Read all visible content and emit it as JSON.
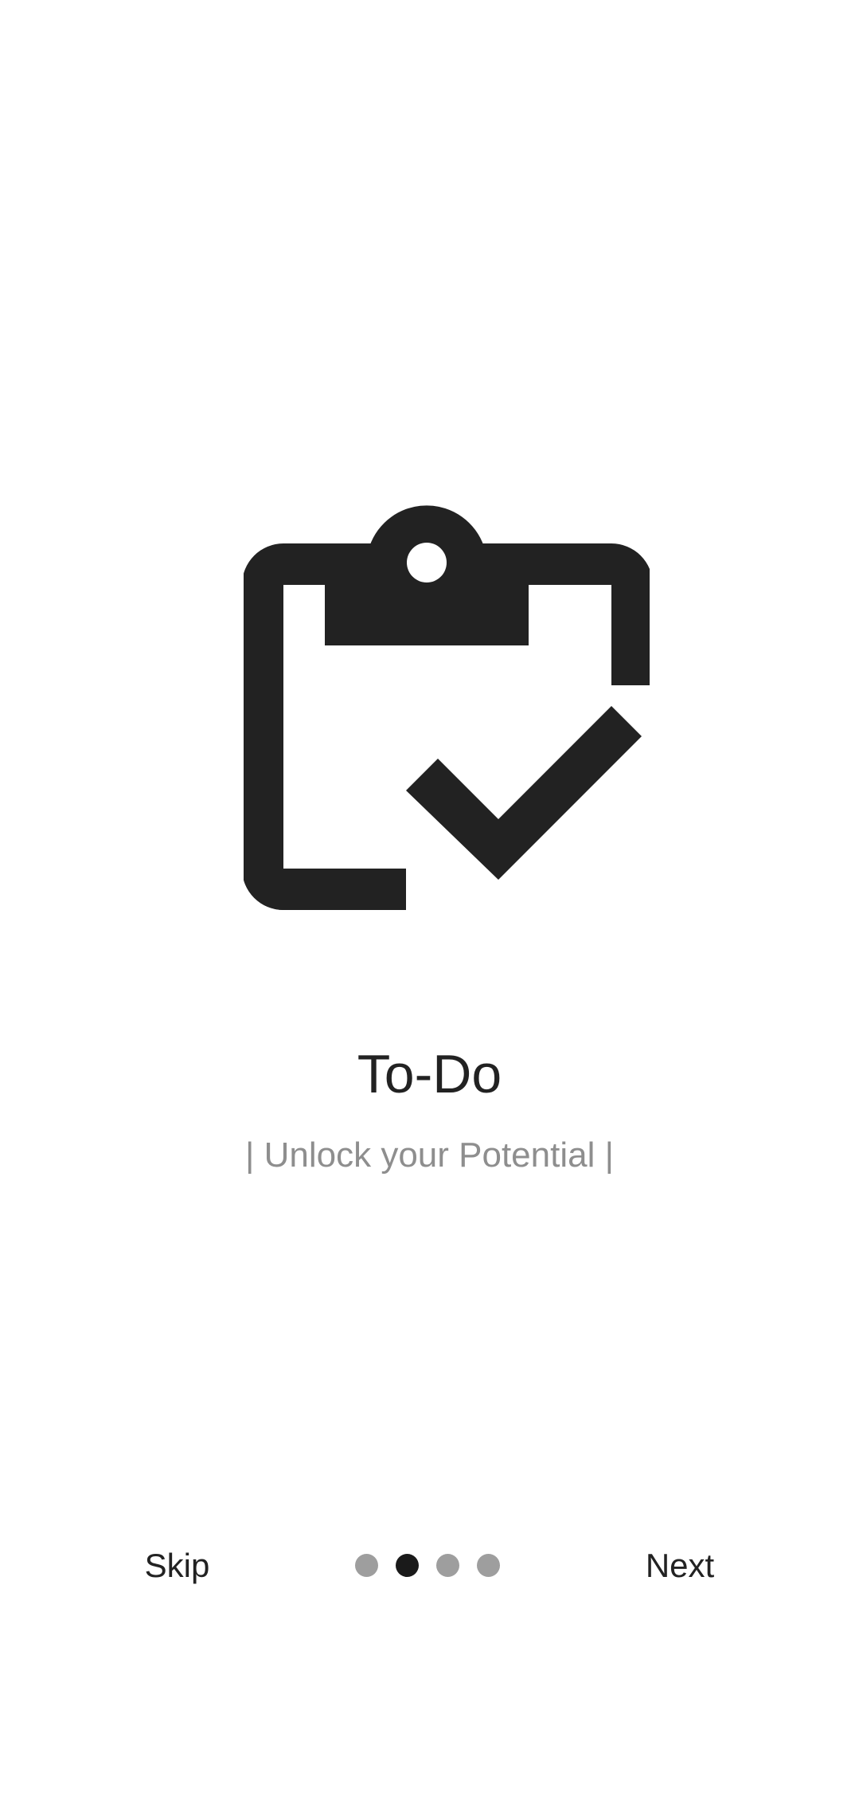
{
  "onboarding": {
    "icon": "clipboard-check-icon",
    "title": "To-Do",
    "subtitle": "| Unlock your Potential |"
  },
  "navigation": {
    "skip_label": "Skip",
    "next_label": "Next",
    "page_count": 4,
    "current_page": 2
  },
  "colors": {
    "icon": "#222222",
    "title": "#222222",
    "subtitle": "#8e8e8e",
    "dot_inactive": "#9e9e9e",
    "dot_active": "#1a1a1a"
  }
}
